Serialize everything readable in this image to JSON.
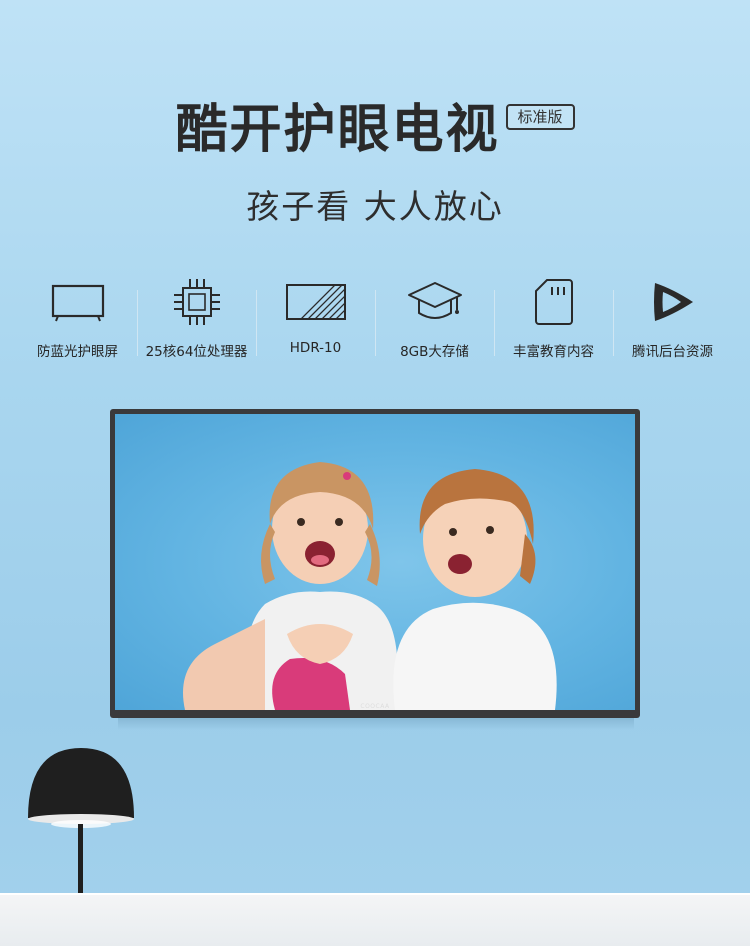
{
  "header": {
    "title": "酷开护眼电视",
    "edition": "标准版",
    "subtitle": "孩子看 大人放心"
  },
  "features": [
    {
      "icon": "tv-icon",
      "label": "防蓝光护眼屏"
    },
    {
      "icon": "chip-icon",
      "label": "25核64位处理器"
    },
    {
      "icon": "hdr-icon",
      "label": "HDR-10"
    },
    {
      "icon": "graduation-cap-icon",
      "label": "8GB大存储"
    },
    {
      "icon": "sd-card-icon",
      "label": "丰富教育内容"
    },
    {
      "icon": "play-logo-icon",
      "label": "腾讯后台资源"
    }
  ],
  "tv": {
    "brand": "COOCAA"
  },
  "colors": {
    "background": "#a9d6ef",
    "title": "#2a2a2a",
    "tv_frame": "#3a3a3c",
    "lamp": "#1f1f1f"
  }
}
